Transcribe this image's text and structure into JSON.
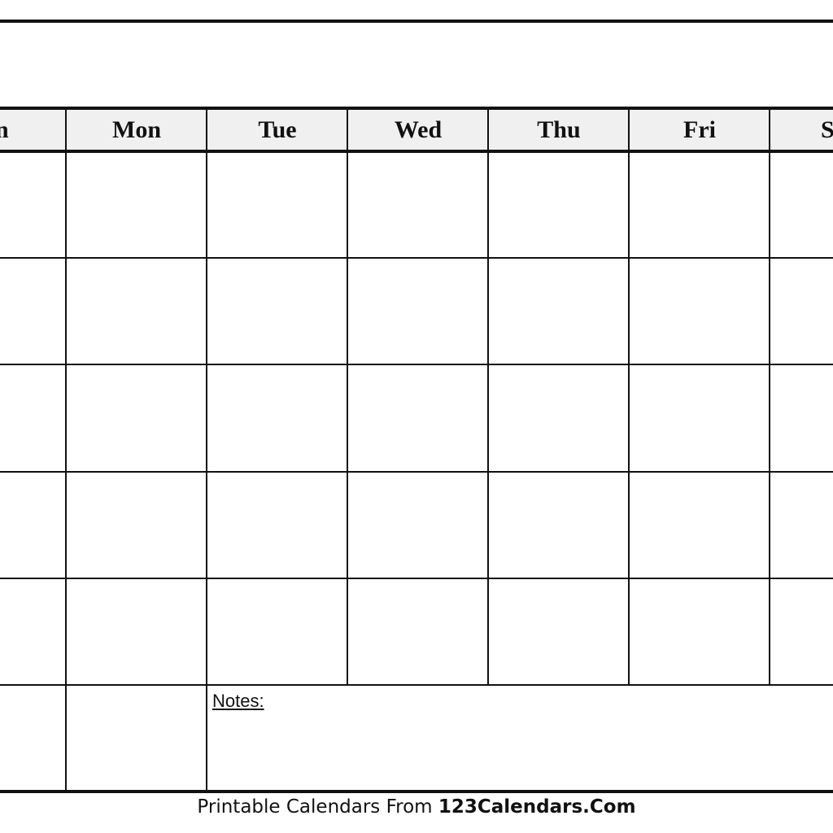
{
  "calendar": {
    "title": "",
    "days": [
      "Sun",
      "Mon",
      "Tue",
      "Wed",
      "Thu",
      "Fri",
      "Sat"
    ],
    "visible_day_labels": [
      "un",
      "Mon",
      "Tue",
      "Wed",
      "Thu",
      "Fri",
      "S"
    ],
    "weeks": 6,
    "cells_empty": true,
    "notes_label": "Notes:",
    "colors": {
      "line": "#111111",
      "header_bg": "#f0f0f0",
      "page_bg": "#ffffff"
    }
  },
  "footer": {
    "prefix": "Printable Calendars From ",
    "brand": "123Calendars.Com"
  }
}
